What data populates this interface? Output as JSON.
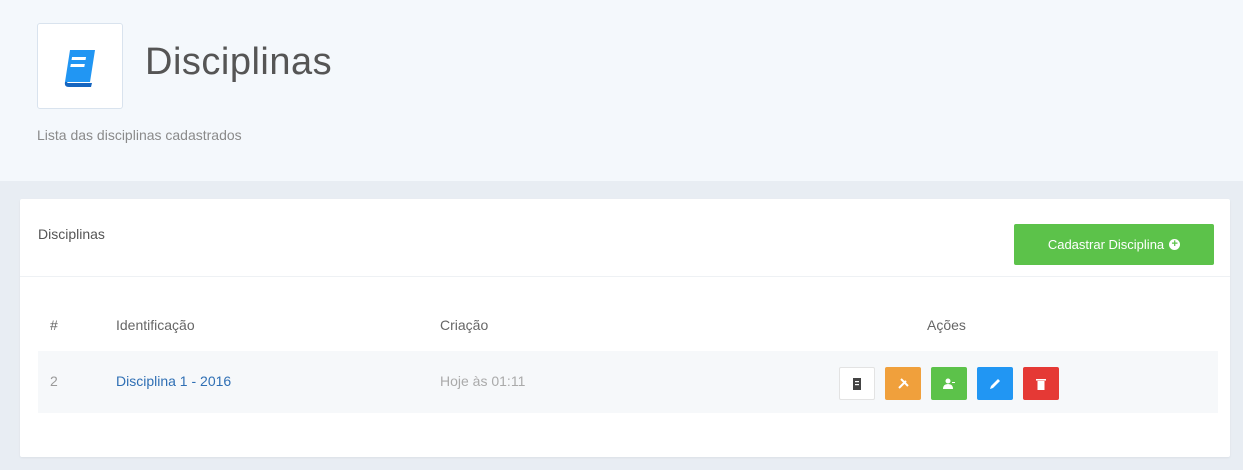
{
  "header": {
    "title": "Disciplinas",
    "subtitle": "Lista das disciplinas cadastrados",
    "icon": "book-icon"
  },
  "card": {
    "title": "Disciplinas",
    "add_button_label": "Cadastrar Disciplina",
    "table": {
      "columns": [
        "#",
        "Identificação",
        "Criação",
        "Ações"
      ],
      "rows": [
        {
          "id": "2",
          "identificacao": "Disciplina 1 - 2016",
          "criacao": "Hoje às 01:11"
        }
      ]
    }
  },
  "actions": [
    {
      "name": "report-icon",
      "color": "#ffffff"
    },
    {
      "name": "tools-icon",
      "color": "#f0a03c"
    },
    {
      "name": "add-user-icon",
      "color": "#5cc24a"
    },
    {
      "name": "pencil-icon",
      "color": "#2196f3"
    },
    {
      "name": "trash-icon",
      "color": "#e53935"
    }
  ],
  "colors": {
    "accent": "#2196f3",
    "success": "#5cc24a",
    "link": "#2f6fb4"
  }
}
